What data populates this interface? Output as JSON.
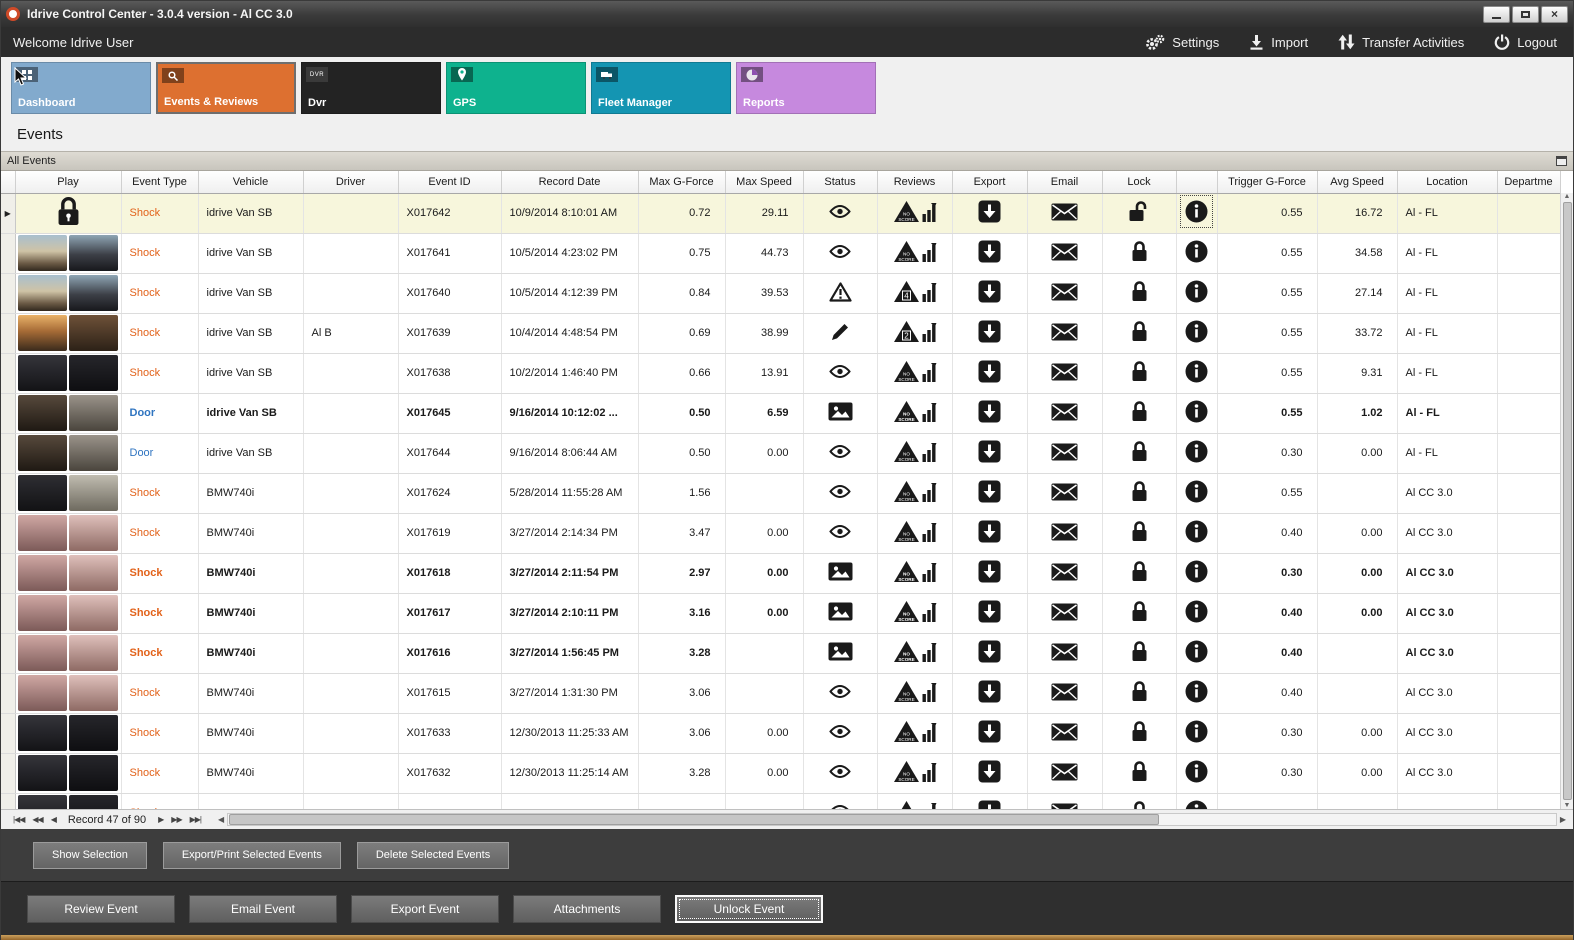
{
  "window": {
    "title": "Idrive Control Center - 3.0.4 version - Al CC 3.0"
  },
  "topbar": {
    "welcome": "Welcome Idrive User",
    "settings": "Settings",
    "import": "Import",
    "transfer": "Transfer Activities",
    "logout": "Logout"
  },
  "modules": [
    {
      "label": "Dashboard",
      "selected": false
    },
    {
      "label": "Events & Reviews",
      "selected": true
    },
    {
      "label": "Dvr",
      "selected": false
    },
    {
      "label": "GPS",
      "selected": false
    },
    {
      "label": "Fleet Manager",
      "selected": false
    },
    {
      "label": "Reports",
      "selected": false
    }
  ],
  "page": {
    "title": "Events",
    "group": "All Events"
  },
  "grid": {
    "columns": [
      "",
      "Play",
      "Event Type",
      "Vehicle",
      "Driver",
      "Event ID",
      "Record Date",
      "Max G-Force",
      "Max Speed",
      "Status",
      "Reviews",
      "Export",
      "Email",
      "Lock",
      "",
      "Trigger G-Force",
      "Avg Speed",
      "Location",
      "Departme"
    ],
    "rows": [
      {
        "selected": true,
        "play": "lock",
        "type": "Shock",
        "vehicle": "idrive Van SB",
        "driver": "",
        "event_id": "X017642",
        "date": "10/9/2014 8:10:01 AM",
        "max_g": "0.72",
        "max_speed": "29.11",
        "status": "eye",
        "review": "no",
        "lock": "unlocked",
        "info_focus": true,
        "trigger_g": "0.55",
        "avg_speed": "16.72",
        "location": "Al - FL",
        "bold": false
      },
      {
        "thumb": "sky",
        "type": "Shock",
        "vehicle": "idrive Van SB",
        "driver": "",
        "event_id": "X017641",
        "date": "10/5/2014 4:23:02 PM",
        "max_g": "0.75",
        "max_speed": "44.73",
        "status": "eye",
        "review": "no",
        "lock": "locked",
        "trigger_g": "0.55",
        "avg_speed": "34.58",
        "location": "Al - FL",
        "bold": false
      },
      {
        "thumb": "sky",
        "type": "Shock",
        "vehicle": "idrive Van SB",
        "driver": "",
        "event_id": "X017640",
        "date": "10/5/2014 4:12:39 PM",
        "max_g": "0.84",
        "max_speed": "39.53",
        "status": "warning",
        "review": "4",
        "lock": "locked",
        "trigger_g": "0.55",
        "avg_speed": "27.14",
        "location": "Al - FL",
        "bold": false
      },
      {
        "thumb": "sunset",
        "type": "Shock",
        "vehicle": "idrive Van SB",
        "driver": "Al B",
        "event_id": "X017639",
        "date": "10/4/2014 4:48:54 PM",
        "max_g": "0.69",
        "max_speed": "38.99",
        "status": "pencil",
        "review": "2",
        "lock": "locked",
        "trigger_g": "0.55",
        "avg_speed": "33.72",
        "location": "Al - FL",
        "bold": false
      },
      {
        "thumb": "dark",
        "type": "Shock",
        "vehicle": "idrive Van SB",
        "driver": "",
        "event_id": "X017638",
        "date": "10/2/2014 1:46:40 PM",
        "max_g": "0.66",
        "max_speed": "13.91",
        "status": "eye",
        "review": "no",
        "lock": "locked",
        "trigger_g": "0.55",
        "avg_speed": "9.31",
        "location": "Al - FL",
        "bold": false
      },
      {
        "thumb": "cabin",
        "type": "Door",
        "vehicle": "idrive Van SB",
        "driver": "",
        "event_id": "X017645",
        "date": "9/16/2014 10:12:02 ...",
        "max_g": "0.50",
        "max_speed": "6.59",
        "status": "image",
        "review": "no",
        "lock": "locked",
        "trigger_g": "0.55",
        "avg_speed": "1.02",
        "location": "Al - FL",
        "bold": true
      },
      {
        "thumb": "cabin",
        "type": "Door",
        "vehicle": "idrive Van SB",
        "driver": "",
        "event_id": "X017644",
        "date": "9/16/2014 8:06:44 AM",
        "max_g": "0.50",
        "max_speed": "0.00",
        "status": "eye",
        "review": "no",
        "lock": "locked",
        "trigger_g": "0.30",
        "avg_speed": "0.00",
        "location": "Al - FL",
        "bold": false
      },
      {
        "thumb": "room",
        "type": "Shock",
        "vehicle": "BMW740i",
        "driver": "",
        "event_id": "X017624",
        "date": "5/28/2014 11:55:28 AM",
        "max_g": "1.56",
        "max_speed": "",
        "status": "eye",
        "review": "no",
        "lock": "locked",
        "trigger_g": "0.55",
        "avg_speed": "",
        "location": "Al CC 3.0",
        "bold": false
      },
      {
        "thumb": "ir",
        "type": "Shock",
        "vehicle": "BMW740i",
        "driver": "",
        "event_id": "X017619",
        "date": "3/27/2014 2:14:34 PM",
        "max_g": "3.47",
        "max_speed": "0.00",
        "status": "eye",
        "review": "no",
        "lock": "locked",
        "trigger_g": "0.40",
        "avg_speed": "0.00",
        "location": "Al CC 3.0",
        "bold": false
      },
      {
        "thumb": "ir",
        "type": "Shock",
        "vehicle": "BMW740i",
        "driver": "",
        "event_id": "X017618",
        "date": "3/27/2014 2:11:54 PM",
        "max_g": "2.97",
        "max_speed": "0.00",
        "status": "image",
        "review": "no",
        "lock": "locked",
        "trigger_g": "0.30",
        "avg_speed": "0.00",
        "location": "Al CC 3.0",
        "bold": true
      },
      {
        "thumb": "ir",
        "type": "Shock",
        "vehicle": "BMW740i",
        "driver": "",
        "event_id": "X017617",
        "date": "3/27/2014 2:10:11 PM",
        "max_g": "3.16",
        "max_speed": "0.00",
        "status": "image",
        "review": "no",
        "lock": "locked",
        "trigger_g": "0.40",
        "avg_speed": "0.00",
        "location": "Al CC 3.0",
        "bold": true
      },
      {
        "thumb": "ir",
        "type": "Shock",
        "vehicle": "BMW740i",
        "driver": "",
        "event_id": "X017616",
        "date": "3/27/2014 1:56:45 PM",
        "max_g": "3.28",
        "max_speed": "",
        "status": "image",
        "review": "no",
        "lock": "locked",
        "trigger_g": "0.40",
        "avg_speed": "",
        "location": "Al CC 3.0",
        "bold": true
      },
      {
        "thumb": "ir",
        "type": "Shock",
        "vehicle": "BMW740i",
        "driver": "",
        "event_id": "X017615",
        "date": "3/27/2014 1:31:30 PM",
        "max_g": "3.06",
        "max_speed": "",
        "status": "eye",
        "review": "no",
        "lock": "locked",
        "trigger_g": "0.40",
        "avg_speed": "",
        "location": "Al CC 3.0",
        "bold": false
      },
      {
        "thumb": "dark",
        "type": "Shock",
        "vehicle": "BMW740i",
        "driver": "",
        "event_id": "X017633",
        "date": "12/30/2013 11:25:33 AM",
        "max_g": "3.06",
        "max_speed": "0.00",
        "status": "eye",
        "review": "no",
        "lock": "locked",
        "trigger_g": "0.30",
        "avg_speed": "0.00",
        "location": "Al CC 3.0",
        "bold": false
      },
      {
        "thumb": "dark",
        "type": "Shock",
        "vehicle": "BMW740i",
        "driver": "",
        "event_id": "X017632",
        "date": "12/30/2013 11:25:14 AM",
        "max_g": "3.28",
        "max_speed": "0.00",
        "status": "eye",
        "review": "no",
        "lock": "locked",
        "trigger_g": "0.30",
        "avg_speed": "0.00",
        "location": "Al CC 3.0",
        "bold": false
      },
      {
        "thumb": "dark",
        "type": "Shock",
        "vehicle": "",
        "driver": "",
        "event_id": "",
        "date": "",
        "max_g": "",
        "max_speed": "",
        "status": "eye",
        "review": "no",
        "lock": "locked",
        "trigger_g": "",
        "avg_speed": "",
        "location": "",
        "bold": false
      }
    ]
  },
  "pager": {
    "record": "Record 47 of 90"
  },
  "selection_bar": {
    "buttons": [
      "Show Selection",
      "Export/Print Selected Events",
      "Delete Selected  Events"
    ]
  },
  "actions_bar": {
    "buttons": [
      "Review Event",
      "Email Event",
      "Export Event",
      "Attachments",
      "Unlock Event"
    ],
    "focused": "Unlock Event"
  }
}
